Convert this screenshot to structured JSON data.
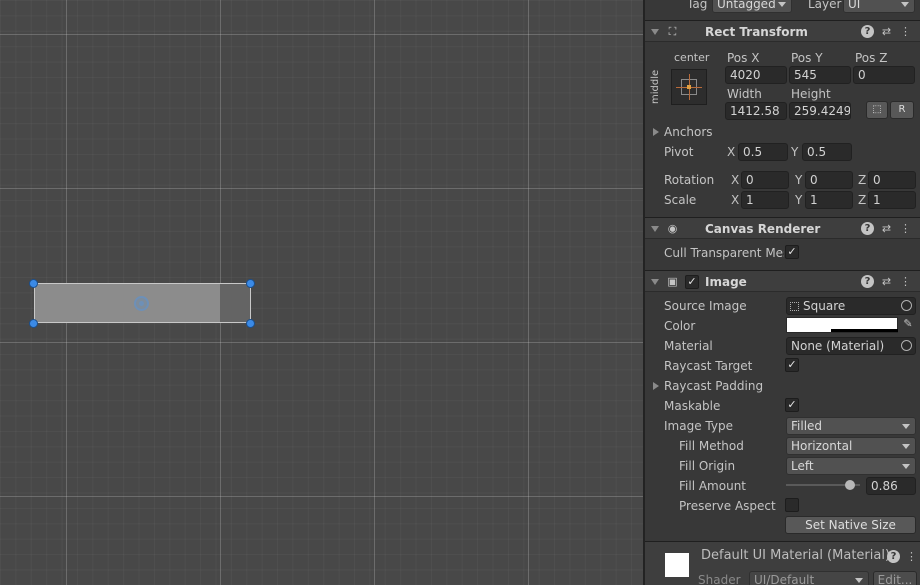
{
  "tag_layer": {
    "tag_label": "Tag",
    "tag_value": "Untagged",
    "layer_label": "Layer",
    "layer_value": "UI"
  },
  "rect_transform": {
    "title": "Rect Transform",
    "anchor_h": "center",
    "anchor_v": "middle",
    "pos_x_label": "Pos X",
    "pos_y_label": "Pos Y",
    "pos_z_label": "Pos Z",
    "pos_x": "4020",
    "pos_y": "545",
    "pos_z": "0",
    "width_label": "Width",
    "height_label": "Height",
    "width": "1412.58",
    "height": "259.4249",
    "r_button": "R",
    "anchors_label": "Anchors",
    "pivot_label": "Pivot",
    "pivot_x": "0.5",
    "pivot_y": "0.5",
    "rotation_label": "Rotation",
    "rotation_x": "0",
    "rotation_y": "0",
    "rotation_z": "0",
    "scale_label": "Scale",
    "scale_x": "1",
    "scale_y": "1",
    "scale_z": "1",
    "axis_x": "X",
    "axis_y": "Y",
    "axis_z": "Z"
  },
  "canvas_renderer": {
    "title": "Canvas Renderer",
    "cull_label": "Cull Transparent Mes",
    "cull_checked": "✓"
  },
  "image": {
    "title": "Image",
    "enabled_check": "✓",
    "source_image_label": "Source Image",
    "source_image_value": "Square",
    "color_label": "Color",
    "material_label": "Material",
    "material_value": "None (Material)",
    "raycast_target_label": "Raycast Target",
    "raycast_target_check": "✓",
    "raycast_padding_label": "Raycast Padding",
    "maskable_label": "Maskable",
    "maskable_check": "✓",
    "image_type_label": "Image Type",
    "image_type_value": "Filled",
    "fill_method_label": "Fill Method",
    "fill_method_value": "Horizontal",
    "fill_origin_label": "Fill Origin",
    "fill_origin_value": "Left",
    "fill_amount_label": "Fill Amount",
    "fill_amount_value": "0.86",
    "fill_amount": 0.86,
    "preserve_aspect_label": "Preserve Aspect",
    "set_native_size": "Set Native Size"
  },
  "material_footer": {
    "title": "Default UI Material (Material)",
    "shader_label": "Shader",
    "shader_value": "UI/Default",
    "edit_button": "Edit..."
  }
}
